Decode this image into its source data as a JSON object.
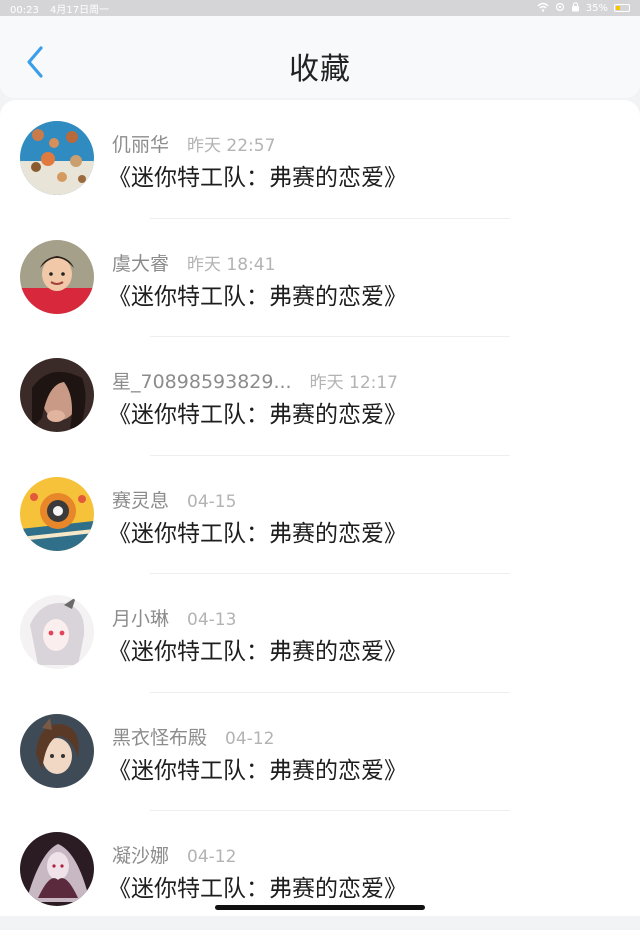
{
  "status": {
    "time": "00:23",
    "date": "4月17日周一",
    "battery": "35%",
    "battery_level": 0.35
  },
  "header": {
    "title": "收藏"
  },
  "items": [
    {
      "name": "仉丽华",
      "time": "昨天 22:57",
      "title": "《迷你特工队：弗赛的恋爱》"
    },
    {
      "name": "虞大睿",
      "time": "昨天 18:41",
      "title": "《迷你特工队：弗赛的恋爱》"
    },
    {
      "name": "星_70898593829...",
      "time": "昨天 12:17",
      "title": "《迷你特工队：弗赛的恋爱》"
    },
    {
      "name": "赛灵息",
      "time": "04-15",
      "title": "《迷你特工队：弗赛的恋爱》"
    },
    {
      "name": "月小琳",
      "time": "04-13",
      "title": "《迷你特工队：弗赛的恋爱》"
    },
    {
      "name": "黑衣怪布殿",
      "time": "04-12",
      "title": "《迷你特工队：弗赛的恋爱》"
    },
    {
      "name": "凝沙娜",
      "time": "04-12",
      "title": "《迷你特工队：弗赛的恋爱》"
    }
  ]
}
